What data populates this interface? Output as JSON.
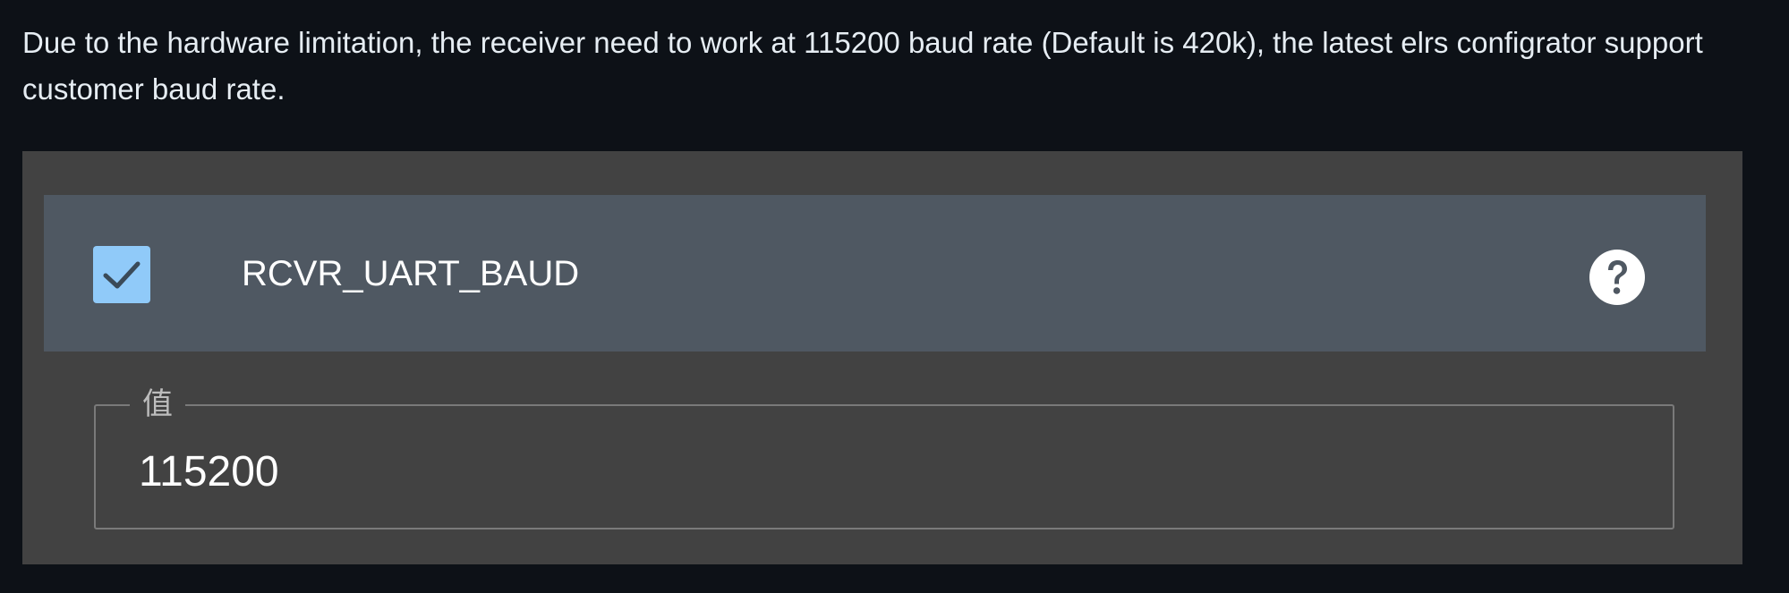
{
  "note": {
    "text": "Due to the hardware limitation, the receiver need to work at 115200 baud rate (Default is 420k), the latest elrs configrator support customer baud rate."
  },
  "option": {
    "label": "RCVR_UART_BAUD",
    "checked": true,
    "checkbox_icon": "check-icon",
    "help_icon": "help-circle-icon"
  },
  "value_field": {
    "legend": "值",
    "value": "115200"
  },
  "colors": {
    "page_background": "#0d1117",
    "panel_background": "#424242",
    "row_background": "#4f5862",
    "checkbox_accent": "#90caf9"
  }
}
